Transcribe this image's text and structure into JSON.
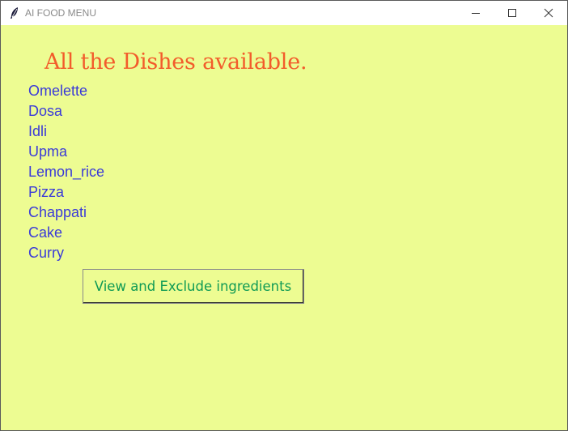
{
  "window": {
    "title": "AI FOOD MENU",
    "app_icon": "feather-icon",
    "controls": [
      "minimize-icon",
      "maximize-icon",
      "close-icon"
    ]
  },
  "main": {
    "heading": "All the Dishes available.",
    "dishes": [
      "Omelette",
      "Dosa",
      "Idli",
      "Upma",
      "Lemon_rice",
      "Pizza",
      "Chappati",
      "Cake",
      "Curry"
    ],
    "action_button_label": "View and Exclude ingredients"
  },
  "colors": {
    "background": "#edfc92",
    "heading": "#f25c2b",
    "dish_text": "#3a3ad8",
    "button_text": "#0f9a55"
  }
}
